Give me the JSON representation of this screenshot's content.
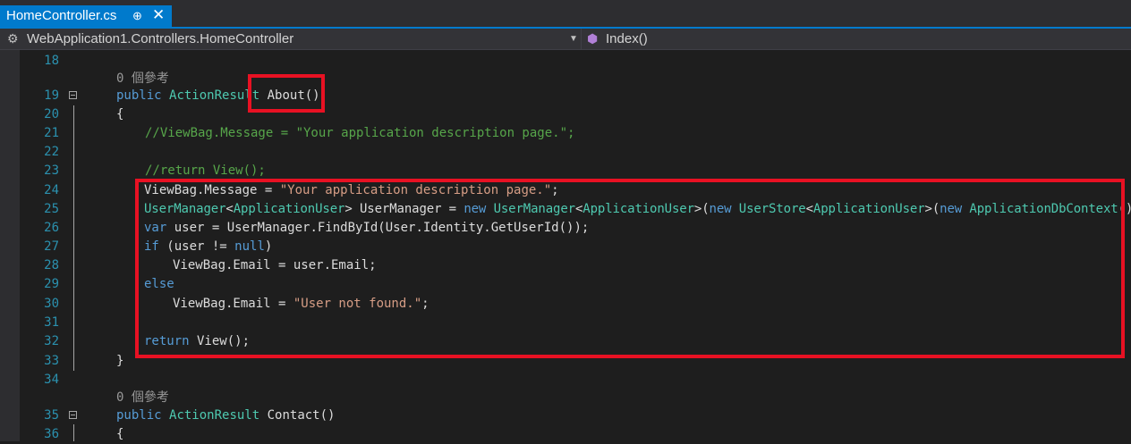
{
  "tab": {
    "title": "HomeController.cs",
    "pin": "⊕",
    "close": "✕"
  },
  "navbar": {
    "namespace_icon": "class-icon",
    "namespace": "WebApplication1.Controllers.HomeController",
    "member_icon": "method-icon",
    "member": "Index()"
  },
  "refs": {
    "about": "0 個參考",
    "contact": "0 個參考"
  },
  "lines": [
    {
      "n": "18"
    },
    {
      "n": "19"
    },
    {
      "n": "20"
    },
    {
      "n": "21"
    },
    {
      "n": "22"
    },
    {
      "n": "23"
    },
    {
      "n": "24"
    },
    {
      "n": "25"
    },
    {
      "n": "26"
    },
    {
      "n": "27"
    },
    {
      "n": "28"
    },
    {
      "n": "29"
    },
    {
      "n": "30"
    },
    {
      "n": "31"
    },
    {
      "n": "32"
    },
    {
      "n": "33"
    },
    {
      "n": "34"
    },
    {
      "n": "35"
    },
    {
      "n": "36"
    }
  ],
  "code": {
    "l19": [
      "public",
      "ActionResult",
      "About()"
    ],
    "l20": "{",
    "l21": "//ViewBag.Message = \"Your application description page.\";",
    "l23": "//return View();",
    "l24": [
      "ViewBag.Message = ",
      "\"Your application description page.\"",
      ";"
    ],
    "l25": [
      "UserManager",
      "<",
      "ApplicationUser",
      "> UserManager = ",
      "new",
      "UserManager",
      "<",
      "ApplicationUser",
      ">(",
      "new",
      "UserStore",
      "<",
      "ApplicationUser",
      ">(",
      "new",
      "ApplicationDbContext",
      "()));"
    ],
    "l26": [
      "var",
      " user = UserManager.FindById(User.Identity.GetUserId());"
    ],
    "l27": [
      "if",
      " (user != ",
      "null",
      ")"
    ],
    "l28": "ViewBag.Email = user.Email;",
    "l29": "else",
    "l30": [
      "ViewBag.Email = ",
      "\"User not found.\"",
      ";"
    ],
    "l32": [
      "return",
      " View();"
    ],
    "l33": "}",
    "l35": [
      "public",
      "ActionResult",
      " Contact()"
    ],
    "l36": "{"
  },
  "colors": {
    "keyword": "#569cd6",
    "type": "#4ec9b0",
    "string": "#d69d85",
    "comment": "#57a64a",
    "highlight": "#e81123",
    "tab_active": "#007acc"
  }
}
